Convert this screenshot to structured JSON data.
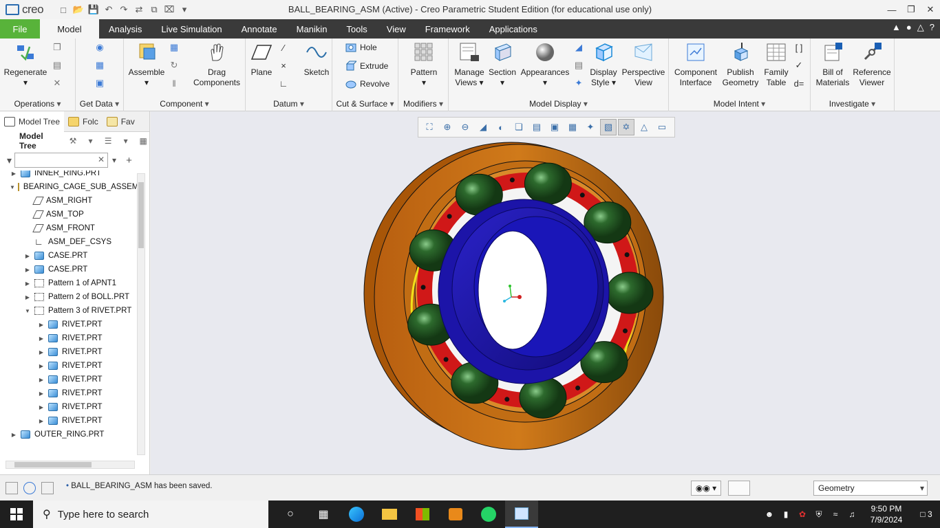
{
  "app": {
    "logo": "creo",
    "window_title": "BALL_BEARING_ASM (Active) - Creo Parametric Student Edition (for educational use only)"
  },
  "ribbon_tabs": [
    "File",
    "Model",
    "Analysis",
    "Live Simulation",
    "Annotate",
    "Manikin",
    "Tools",
    "View",
    "Framework",
    "Applications"
  ],
  "active_tab": "Model",
  "groups": {
    "operations": "Operations",
    "get_data": "Get Data",
    "component": "Component",
    "datum": "Datum",
    "cut_surface": "Cut & Surface",
    "modifiers": "Modifiers",
    "model_display": "Model Display",
    "model_intent": "Model Intent",
    "investigate": "Investigate"
  },
  "buttons": {
    "regenerate": "Regenerate",
    "assemble": "Assemble",
    "drag_components_1": "Drag",
    "drag_components_2": "Components",
    "plane": "Plane",
    "sketch": "Sketch",
    "hole": "Hole",
    "extrude": "Extrude",
    "revolve": "Revolve",
    "pattern": "Pattern",
    "manage_views_1": "Manage",
    "manage_views_2": "Views",
    "section": "Section",
    "appearances": "Appearances",
    "display_style_1": "Display",
    "display_style_2": "Style",
    "perspective_view_1": "Perspective",
    "perspective_view_2": "View",
    "component_interface_1": "Component",
    "component_interface_2": "Interface",
    "publish_geometry_1": "Publish",
    "publish_geometry_2": "Geometry",
    "family_table_1": "Family",
    "family_table_2": "Table",
    "bill_of_materials_1": "Bill of",
    "bill_of_materials_2": "Materials",
    "reference_viewer_1": "Reference",
    "reference_viewer_2": "Viewer"
  },
  "panel": {
    "tabs": [
      "Model Tree",
      "Folc",
      "Fav"
    ],
    "header": "Model Tree",
    "search_placeholder": ""
  },
  "tree": [
    {
      "label": "INNER_RING.PRT",
      "icon": "part",
      "level": 1,
      "expander": "right"
    },
    {
      "label": "BEARING_CAGE_SUB_ASSEM",
      "icon": "asm",
      "level": 1,
      "expander": "down"
    },
    {
      "label": "ASM_RIGHT",
      "icon": "plane",
      "level": 2,
      "expander": ""
    },
    {
      "label": "ASM_TOP",
      "icon": "plane",
      "level": 2,
      "expander": ""
    },
    {
      "label": "ASM_FRONT",
      "icon": "plane",
      "level": 2,
      "expander": ""
    },
    {
      "label": "ASM_DEF_CSYS",
      "icon": "csys",
      "level": 2,
      "expander": ""
    },
    {
      "label": "CASE.PRT",
      "icon": "part",
      "level": 2,
      "expander": "right"
    },
    {
      "label": "CASE.PRT",
      "icon": "part",
      "level": 2,
      "expander": "right"
    },
    {
      "label": "Pattern 1 of APNT1",
      "icon": "pattern",
      "level": 2,
      "expander": "right"
    },
    {
      "label": "Pattern 2 of BOLL.PRT",
      "icon": "pattern",
      "level": 2,
      "expander": "right"
    },
    {
      "label": "Pattern 3 of RIVET.PRT",
      "icon": "pattern",
      "level": 2,
      "expander": "down"
    },
    {
      "label": "RIVET.PRT",
      "icon": "part",
      "level": 3,
      "expander": "right"
    },
    {
      "label": "RIVET.PRT",
      "icon": "part",
      "level": 3,
      "expander": "right"
    },
    {
      "label": "RIVET.PRT",
      "icon": "part",
      "level": 3,
      "expander": "right"
    },
    {
      "label": "RIVET.PRT",
      "icon": "part",
      "level": 3,
      "expander": "right"
    },
    {
      "label": "RIVET.PRT",
      "icon": "part",
      "level": 3,
      "expander": "right"
    },
    {
      "label": "RIVET.PRT",
      "icon": "part",
      "level": 3,
      "expander": "right"
    },
    {
      "label": "RIVET.PRT",
      "icon": "part",
      "level": 3,
      "expander": "right"
    },
    {
      "label": "RIVET.PRT",
      "icon": "part",
      "level": 3,
      "expander": "right"
    },
    {
      "label": "OUTER_RING.PRT",
      "icon": "part",
      "level": 1,
      "expander": "right"
    }
  ],
  "status": {
    "message": "BALL_BEARING_ASM has been saved.",
    "filter_value": "Geometry"
  },
  "taskbar": {
    "search_text": "Type here to search",
    "time": "9:50 PM",
    "date": "7/9/2024",
    "notifications": "3"
  },
  "colors": {
    "outer_ring": "#d07a1a",
    "inner_ring": "#1c14a8",
    "balls": "#1f4a1f",
    "cage": "#d01818",
    "file_tab": "#58b33a",
    "tab_bar": "#3a3a3a"
  }
}
